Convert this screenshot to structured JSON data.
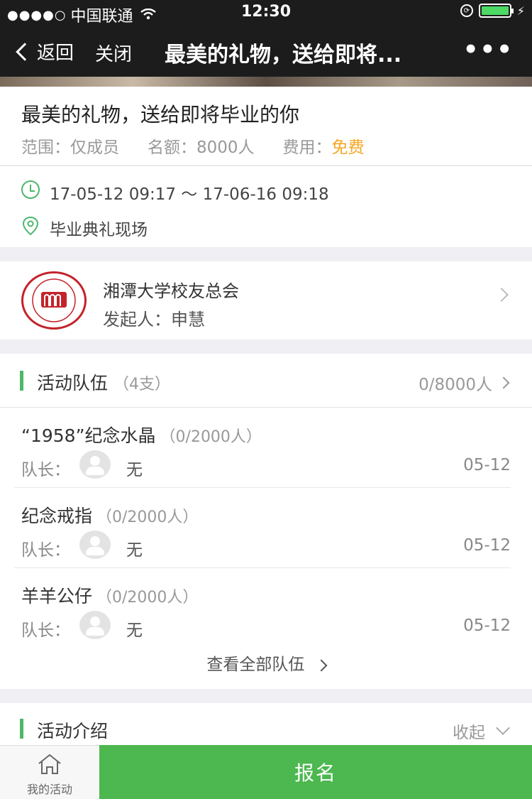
{
  "status_bar": {
    "signal_dots": "●●●●○",
    "carrier": "中国联通",
    "time": "12:30"
  },
  "nav": {
    "back_label": "返回",
    "close_label": "关闭",
    "title": "最美的礼物，送给即将...",
    "more_label": "•••"
  },
  "event": {
    "title": "最美的礼物，送给即将毕业的你",
    "scope": "范围：仅成员",
    "quota": "名额：8000人",
    "fee_label": "费用：",
    "fee_value": "免费",
    "time_range": "17-05-12 09:17 ～ 17-06-16 09:18",
    "location": "毕业典礼现场"
  },
  "organizer": {
    "name": "湘潭大学校友总会",
    "host": "发起人：申慧"
  },
  "teams": {
    "section_title": "活动队伍",
    "count": "（4支）",
    "capacity": "0/8000人",
    "leader_label": "队长：",
    "items": [
      {
        "name": "“1958”纪念水晶",
        "capacity": "（0/2000人）",
        "leader": "无",
        "date": "05-12"
      },
      {
        "name": "纪念戒指",
        "capacity": "（0/2000人）",
        "leader": "无",
        "date": "05-12"
      },
      {
        "name": "羊羊公仔",
        "capacity": "（0/2000人）",
        "leader": "无",
        "date": "05-12"
      }
    ],
    "view_all": "查看全部队伍"
  },
  "intro": {
    "section_title": "活动介绍",
    "collapse_label": "收起"
  },
  "tab_bar": {
    "my_activities": "我的活动",
    "signup": "报名"
  },
  "colors": {
    "accent_green": "#4cb84f",
    "fee_orange": "#f5a623",
    "nav_bg": "#1c1c1c"
  }
}
